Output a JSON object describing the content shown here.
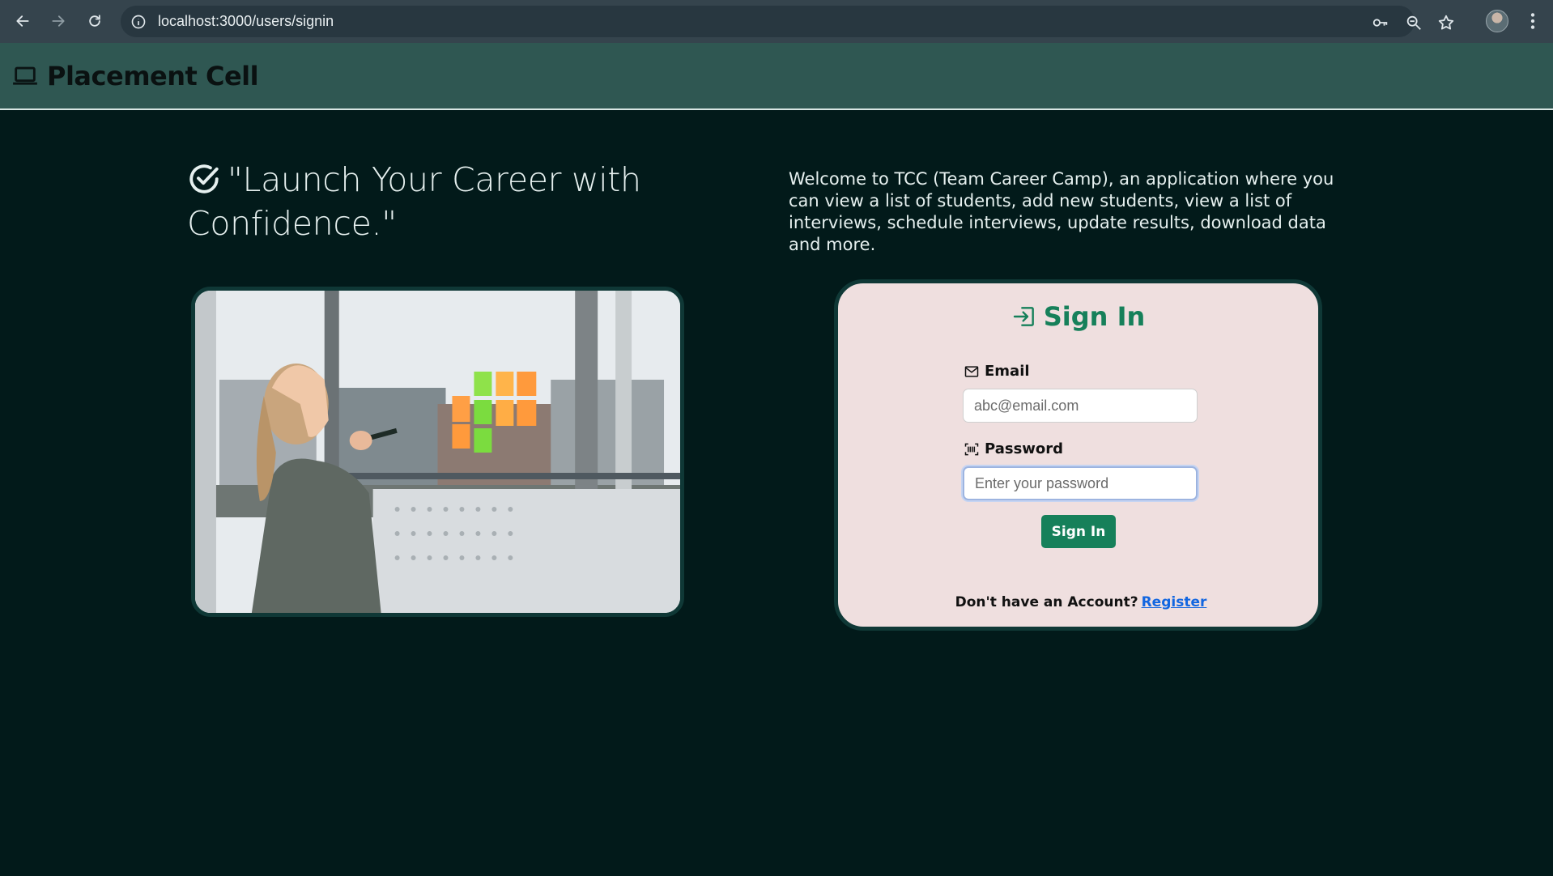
{
  "browser": {
    "url": "localhost:3000/users/signin",
    "icons": [
      "back-arrow-icon",
      "forward-arrow-icon",
      "reload-icon",
      "info-icon",
      "key-icon",
      "zoom-icon",
      "star-icon",
      "profile-avatar",
      "menu-dots-icon"
    ]
  },
  "header": {
    "brand_title": "Placement Cell",
    "brand_icon": "laptop-icon"
  },
  "hero": {
    "tagline": "\"Launch Your Career with Confidence.\"",
    "tagline_icon": "check-circle-icon",
    "welcome_text": "Welcome to TCC (Team Career Camp), an application where you can view a list of students, add new students, view a list of interviews, schedule interviews, update results, download data and more."
  },
  "signin": {
    "title": "Sign In",
    "title_icon": "sign-in-icon",
    "email_label": "Email",
    "email_icon": "envelope-icon",
    "email_placeholder": "abc@email.com",
    "email_value": "",
    "password_label": "Password",
    "password_icon": "password-field-icon",
    "password_placeholder": "Enter your password",
    "password_value": "",
    "submit_label": "Sign In",
    "register_prompt": "Don't have an Account?",
    "register_link": "Register"
  },
  "colors": {
    "page_bg": "#021a1a",
    "header_bg": "#2f5752",
    "card_bg": "#efdfdf",
    "accent_green": "#16805a",
    "link_blue": "#1266e0"
  }
}
